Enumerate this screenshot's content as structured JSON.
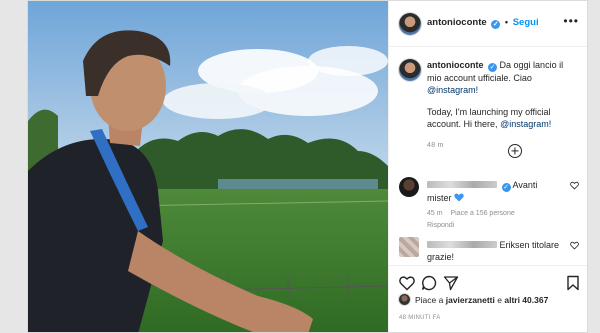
{
  "post": {
    "username": "antonioconte",
    "verified_mark": "✓",
    "separator": "•",
    "follow_label": "Segui",
    "more_label": "•••",
    "caption_user": "antonioconte",
    "caption_it": "Da oggi lancio il mio account ufficiale. Ciao",
    "caption_it_mention": "@instagram!",
    "caption_en": "Today, I'm launching my official account. Hi there,",
    "caption_en_mention": "@instagram!",
    "caption_time": "48 m"
  },
  "comments": [
    {
      "text_a": "Avanti",
      "text_b": "mister",
      "time": "45 m",
      "likes": "Piace a 156 persone",
      "reply": "Rispondi"
    },
    {
      "text_a": "Eriksen titolare",
      "text_b": "grazie!"
    }
  ],
  "likes": {
    "prefix": "Piace a",
    "user": "javierzanetti",
    "mid": "e",
    "others": "altri 40.367"
  },
  "posted_time": "48 MINUTI FA",
  "icons": {
    "plus": "add-comment-icon",
    "heart": "heart-icon",
    "comment": "comment-icon",
    "share": "share-icon",
    "save": "bookmark-icon",
    "more": "more-options-icon"
  },
  "colors": {
    "link": "#0095f6",
    "mention": "#00376b",
    "verified": "#3897f0",
    "text": "#262626",
    "muted": "#8e8e8e"
  }
}
